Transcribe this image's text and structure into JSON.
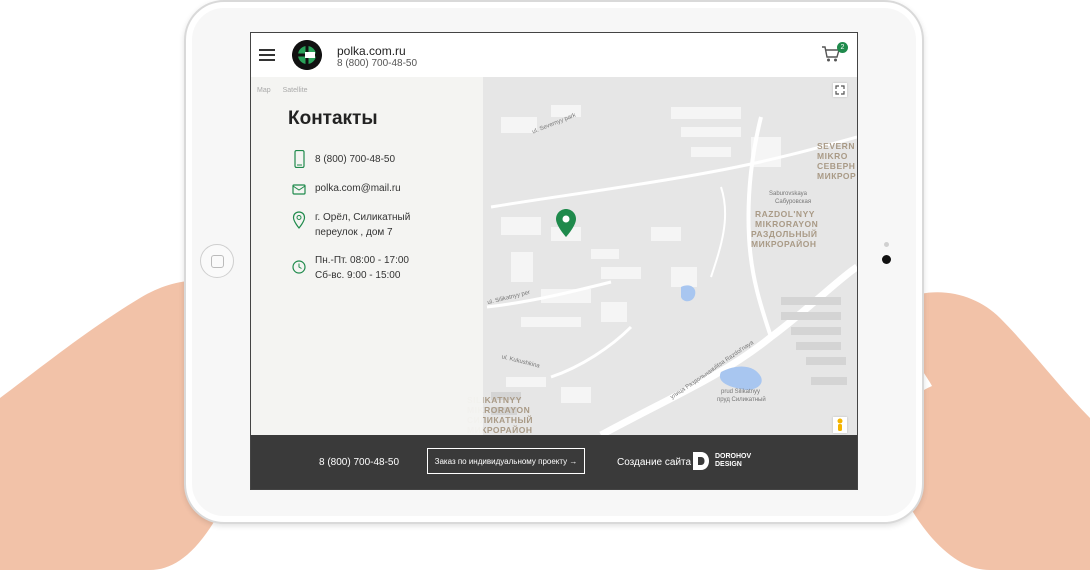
{
  "header": {
    "site_name": "polka.com.ru",
    "phone": "8 (800) 700-48-50",
    "cart_count": "2"
  },
  "map": {
    "tabs": [
      "Map",
      "Satellite"
    ],
    "labels": {
      "severny_lat": "SEVERN MIKRO",
      "severny_cyr": "СЕВЕРН МИКРОР",
      "saburovskaya_lat": "Saburovskaya",
      "saburovskaya_cyr": "Сабуровская",
      "razdolny_lat": "RAZDOL'NYY MIKRORAYON",
      "razdolny_cyr": "РАЗДОЛЬНЫЙ МИКРОРАЙОН",
      "silikatny_lat": "SILIKATNYY MIKRORAYON",
      "silikatny_cyr": "СИЛИКАТНЫЙ МИКРОРАЙОН",
      "prud_lat": "prud Silikatnyy",
      "prud_cyr": "пруд Силикатный",
      "street_razdolnaya_lat": "ulitsa Razdol'naya",
      "street_razdolnaya_cyr": "улица Раздольная",
      "street_silikatny": "ul. Silikatnyy per",
      "street_kukushkina": "ul. Kukushkina",
      "street_severny": "ul. Severnyy park"
    }
  },
  "contacts": {
    "title": "Контакты",
    "phone": "8 (800) 700-48-50",
    "email": "polka.com@mail.ru",
    "address_line1": "г. Орёл, Силикатный",
    "address_line2": "переулок , дом 7",
    "hours_line1": "Пн.-Пт. 08:00 - 17:00",
    "hours_line2": "Сб-вс. 9:00 - 15:00"
  },
  "footer": {
    "phone": "8 (800) 700-48-50",
    "order_button": "Заказ по индивидуальному проекту →",
    "made_by": "Создание сайта",
    "studio_line1": "DOROHOV",
    "studio_line2": "DESIGN"
  },
  "colors": {
    "accent": "#1f8a4c",
    "footer_bg": "#3a3a3a",
    "map_bg": "#e6e6e6",
    "map_label": "#a99a86"
  }
}
